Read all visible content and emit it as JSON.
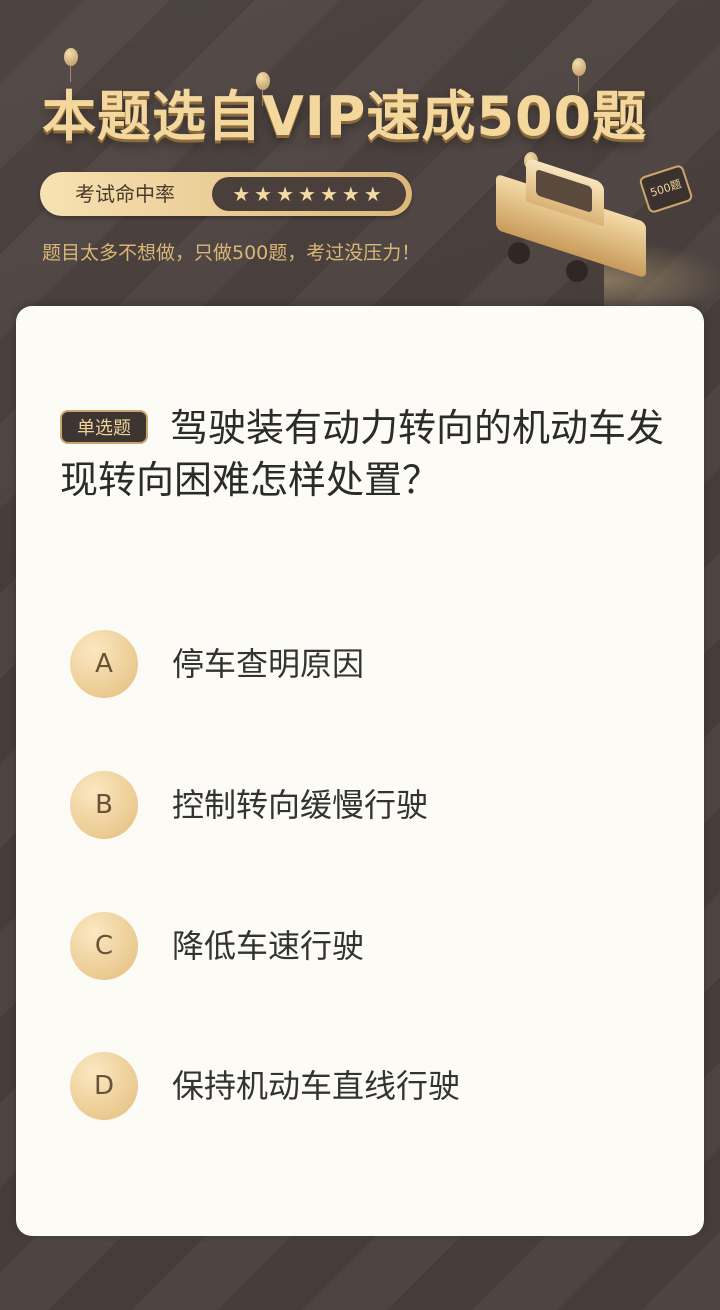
{
  "banner": {
    "title": "本题选自VIP速成500题",
    "rate_label": "考试命中率",
    "rate_stars": "★★★★★★★",
    "tagline": "题目太多不想做，只做500题，考过没压力！",
    "sign_text": "500题",
    "accent_color": "#f3d79c"
  },
  "question": {
    "type_label": "单选题",
    "text": "驾驶装有动力转向的机动车发现转向困难怎样处置？"
  },
  "options": [
    {
      "letter": "A",
      "text": "停车查明原因"
    },
    {
      "letter": "B",
      "text": "控制转向缓慢行驶"
    },
    {
      "letter": "C",
      "text": "降低车速行驶"
    },
    {
      "letter": "D",
      "text": "保持机动车直线行驶"
    }
  ]
}
